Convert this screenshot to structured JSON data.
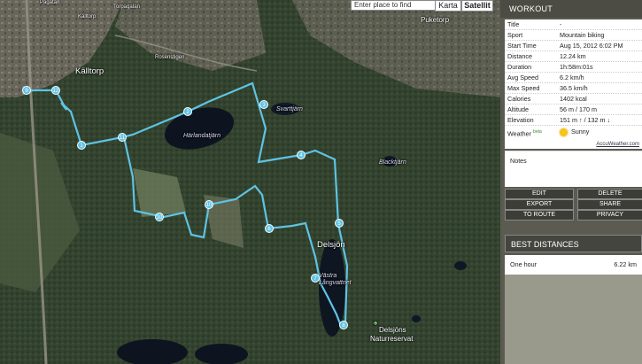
{
  "map": {
    "search_placeholder": "Enter place to find",
    "tab_map": "Karta",
    "tab_satellite": "Satellit",
    "labels": {
      "pagatan": "Pagatan",
      "kalltorp_street": "Källtorp",
      "torpagatan": "Torpagatan",
      "kalltorp": "Källtorp",
      "puketorp": "Puketorp",
      "rosenstigen": "Rosenstigen",
      "svarttjarn": "Svarttjärn",
      "harlandatjarn": "Härlandatjärn",
      "blacktjarn": "Blacktjärn",
      "delsjon": "Delsjön",
      "vastra_langvattnet": "Västra Långvattnet",
      "delsjons_naturreservat_1": "Delsjöns",
      "delsjons_naturreservat_2": "Naturreservat"
    },
    "markers": [
      "9",
      "10",
      "1",
      "11",
      "2",
      "3",
      "4",
      "5",
      "6",
      "7",
      "8",
      "12"
    ]
  },
  "panel": {
    "header": "WORKOUT",
    "rows": [
      {
        "key": "Title",
        "value": "-"
      },
      {
        "key": "Sport",
        "value": "Mountain biking"
      },
      {
        "key": "Start Time",
        "value": "Aug 15, 2012 6:02 PM"
      },
      {
        "key": "Distance",
        "value": "12.24 km"
      },
      {
        "key": "Duration",
        "value": "1h:58m:01s"
      },
      {
        "key": "Avg Speed",
        "value": "6.2 km/h"
      },
      {
        "key": "Max Speed",
        "value": "36.5 km/h"
      },
      {
        "key": "Calories",
        "value": "1402 kcal"
      },
      {
        "key": "Altitude",
        "value": "56 m / 170 m"
      },
      {
        "key": "Elevation",
        "value": "151 m ↑ / 132 m ↓"
      },
      {
        "key": "Weather",
        "value": "Sunny"
      }
    ],
    "weather_beta": "beta",
    "weather_icon": "sun-icon",
    "accuweather": "AccuWeather.com",
    "notes_label": "Notes",
    "buttons": {
      "edit": "EDIT",
      "delete": "DELETE",
      "export": "EXPORT",
      "share": "SHARE",
      "to_route": "TO ROUTE",
      "privacy": "PRIVACY"
    },
    "best_header": "BEST DISTANCES",
    "best_rows": [
      {
        "key": "One hour",
        "value": "6.22 km"
      }
    ]
  },
  "colors": {
    "route": "#5fc3e4",
    "panel_bg": "#5b5b52",
    "header_bg": "#4c4c44"
  }
}
